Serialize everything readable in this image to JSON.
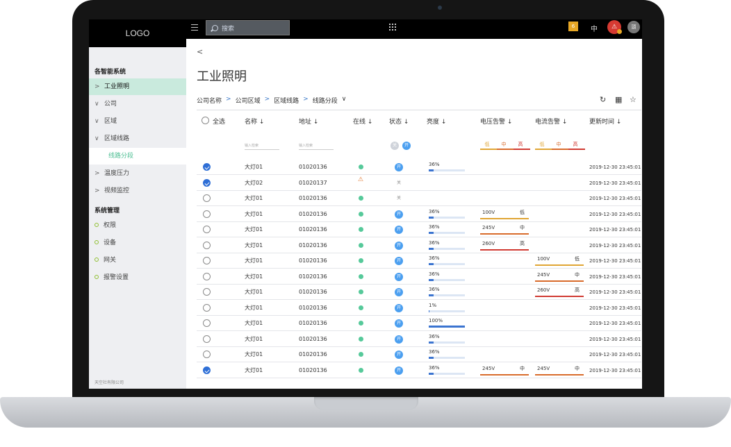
{
  "header": {
    "logo": "LOGO",
    "search_placeholder": "搜索",
    "message_count": "6",
    "language": "中",
    "alert_glyph": "⚠",
    "avatar_text": "頭"
  },
  "sidebar": {
    "group1": "各智能系统",
    "items": [
      {
        "mark": ">",
        "label": "工业照明",
        "active": true
      },
      {
        "mark": "∨",
        "label": "公司"
      },
      {
        "mark": "∨",
        "label": "区域"
      },
      {
        "mark": "∨",
        "label": "区域线路"
      },
      {
        "mark": "",
        "label": "线路分段",
        "sub": true
      },
      {
        "mark": ">",
        "label": "温度压力"
      },
      {
        "mark": ">",
        "label": "视频监控"
      }
    ],
    "group2": "系统管理",
    "mgmt": [
      "权限",
      "设备",
      "网关",
      "报警设置"
    ],
    "footer": "天空社有限公司"
  },
  "main": {
    "back": "<",
    "title": "工业照明",
    "breadcrumb": [
      "公司名称",
      "公司区域",
      "区域线路",
      "线路分段"
    ],
    "breadcrumb_sep": ">",
    "breadcrumb_dropdown": "∨",
    "tools": {
      "refresh": "↻",
      "grid": "▦",
      "star": "☆"
    }
  },
  "table": {
    "select_all": "全选",
    "columns": [
      "名称 ↓",
      "地址 ↓",
      "在线 ↓",
      "状态 ↓",
      "亮度 ↓",
      "电压告警 ↓",
      "电流告警 ↓",
      "更新时间 ↓"
    ],
    "filters": {
      "name_placeholder": "输入检索",
      "addr_placeholder": "输入检索",
      "state_off": "关",
      "state_on": "开",
      "levels": [
        "低",
        "中",
        "高"
      ]
    },
    "level_colors": {
      "低": "#e0a533",
      "中": "#d86a2a",
      "高": "#d03a32"
    },
    "rows": [
      {
        "checked": true,
        "name": "大灯01",
        "addr": "01020136",
        "online": "dot",
        "state": "开",
        "brightness": "36%",
        "bval": 36,
        "v": null,
        "c": null,
        "time": "2019-12-30 23:45:01"
      },
      {
        "checked": true,
        "name": "大灯02",
        "addr": "01020137",
        "online": "warn",
        "state": "关",
        "brightness": null,
        "bval": null,
        "v": null,
        "c": null,
        "time": "2019-12-30 23:45:01"
      },
      {
        "checked": false,
        "name": "大灯01",
        "addr": "01020136",
        "online": "dot",
        "state": "关",
        "brightness": null,
        "bval": null,
        "v": null,
        "c": null,
        "time": "2019-12-30 23:45:01"
      },
      {
        "checked": false,
        "name": "大灯01",
        "addr": "01020136",
        "online": "dot",
        "state": "开",
        "brightness": "36%",
        "bval": 36,
        "v": {
          "value": "100V",
          "level": "低"
        },
        "c": null,
        "time": "2019-12-30 23:45:01"
      },
      {
        "checked": false,
        "name": "大灯01",
        "addr": "01020136",
        "online": "dot",
        "state": "开",
        "brightness": "36%",
        "bval": 36,
        "v": {
          "value": "245V",
          "level": "中"
        },
        "c": null,
        "time": "2019-12-30 23:45:01"
      },
      {
        "checked": false,
        "name": "大灯01",
        "addr": "01020136",
        "online": "dot",
        "state": "开",
        "brightness": "36%",
        "bval": 36,
        "v": {
          "value": "260V",
          "level": "高"
        },
        "c": null,
        "time": "2019-12-30 23:45:01"
      },
      {
        "checked": false,
        "name": "大灯01",
        "addr": "01020136",
        "online": "dot",
        "state": "开",
        "brightness": "36%",
        "bval": 36,
        "v": null,
        "c": {
          "value": "100V",
          "level": "低"
        },
        "time": "2019-12-30 23:45:01"
      },
      {
        "checked": false,
        "name": "大灯01",
        "addr": "01020136",
        "online": "dot",
        "state": "开",
        "brightness": "36%",
        "bval": 36,
        "v": null,
        "c": {
          "value": "245V",
          "level": "中"
        },
        "time": "2019-12-30 23:45:01"
      },
      {
        "checked": false,
        "name": "大灯01",
        "addr": "01020136",
        "online": "dot",
        "state": "开",
        "brightness": "36%",
        "bval": 36,
        "v": null,
        "c": {
          "value": "260V",
          "level": "高"
        },
        "time": "2019-12-30 23:45:01"
      },
      {
        "checked": false,
        "name": "大灯01",
        "addr": "01020136",
        "online": "dot",
        "state": "开",
        "brightness": "1%",
        "bval": 1,
        "v": null,
        "c": null,
        "time": "2019-12-30 23:45:01"
      },
      {
        "checked": false,
        "name": "大灯01",
        "addr": "01020136",
        "online": "dot",
        "state": "开",
        "brightness": "100%",
        "bval": 100,
        "v": null,
        "c": null,
        "time": "2019-12-30 23:45:01"
      },
      {
        "checked": false,
        "name": "大灯01",
        "addr": "01020136",
        "online": "dot",
        "state": "开",
        "brightness": "36%",
        "bval": 36,
        "v": null,
        "c": null,
        "time": "2019-12-30 23:45:01"
      },
      {
        "checked": false,
        "name": "大灯01",
        "addr": "01020136",
        "online": "dot",
        "state": "开",
        "brightness": "36%",
        "bval": 36,
        "v": null,
        "c": null,
        "time": "2019-12-30 23:45:01"
      },
      {
        "checked": true,
        "name": "大灯01",
        "addr": "01020136",
        "online": "dot",
        "state": "开",
        "brightness": "36%",
        "bval": 36,
        "v": {
          "value": "245V",
          "level": "中"
        },
        "c": {
          "value": "245V",
          "level": "中"
        },
        "time": "2019-12-30 23:45:01"
      }
    ]
  }
}
